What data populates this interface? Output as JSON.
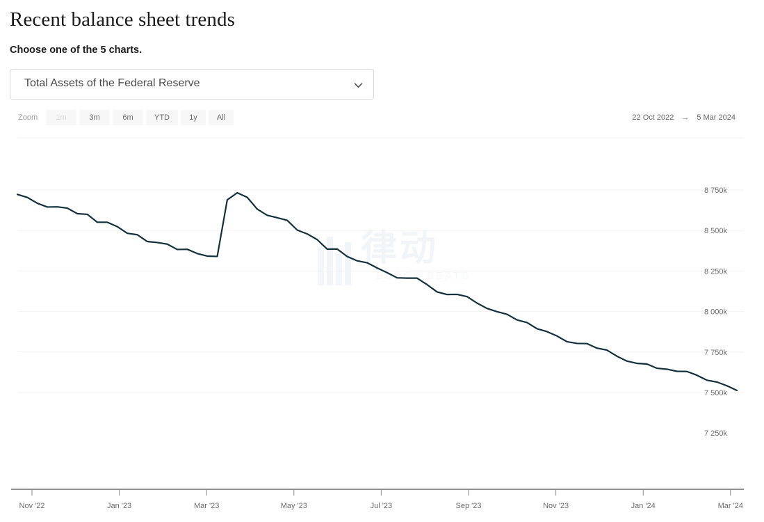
{
  "header": {
    "title": "Recent balance sheet trends",
    "subtitle": "Choose one of the 5 charts."
  },
  "select": {
    "value": "Total Assets of the Federal Reserve",
    "icon": "chevron-down-icon",
    "options": [
      "Total Assets of the Federal Reserve"
    ]
  },
  "rangebar": {
    "zoom_label": "Zoom",
    "buttons": [
      {
        "label": "1m",
        "muted": true
      },
      {
        "label": "3m",
        "muted": false
      },
      {
        "label": "6m",
        "muted": false
      },
      {
        "label": "YTD",
        "muted": false
      },
      {
        "label": "1y",
        "muted": false
      },
      {
        "label": "All",
        "muted": false
      }
    ],
    "start_date": "22 Oct 2022",
    "arrow": "→",
    "end_date": "5 Mar 2024"
  },
  "watermark": {
    "text": "律动",
    "subtext": "BLOCK BEATS",
    "color": "#dfe7ef"
  },
  "chart_data": {
    "type": "line",
    "title": "Total Assets of the Federal Reserve",
    "xlabel": "",
    "ylabel": "",
    "grid": true,
    "legend": "none",
    "line_color": "#13313d",
    "y_ticks": [
      "8 750k",
      "8 500k",
      "8 250k",
      "8 000k",
      "7 750k",
      "7 500k",
      "7 250k"
    ],
    "y_tick_values": [
      8750000,
      8500000,
      8250000,
      8000000,
      7750000,
      7500000,
      7250000
    ],
    "ylim": [
      7250000,
      8850000
    ],
    "x_ticks": [
      "Nov '22",
      "Jan '23",
      "Mar '23",
      "May '23",
      "Jul '23",
      "Sep '23",
      "Nov '23",
      "Jan '24",
      "Mar '24"
    ],
    "x": [
      "2022-10-22",
      "2022-10-29",
      "2022-11-05",
      "2022-11-12",
      "2022-11-19",
      "2022-11-26",
      "2022-12-03",
      "2022-12-10",
      "2022-12-17",
      "2022-12-24",
      "2022-12-31",
      "2023-01-07",
      "2023-01-14",
      "2023-01-21",
      "2023-01-28",
      "2023-02-04",
      "2023-02-11",
      "2023-02-18",
      "2023-02-25",
      "2023-03-04",
      "2023-03-11",
      "2023-03-18",
      "2023-03-25",
      "2023-04-01",
      "2023-04-08",
      "2023-04-15",
      "2023-04-22",
      "2023-04-29",
      "2023-05-06",
      "2023-05-13",
      "2023-05-20",
      "2023-05-27",
      "2023-06-03",
      "2023-06-10",
      "2023-06-17",
      "2023-06-24",
      "2023-07-01",
      "2023-07-08",
      "2023-07-15",
      "2023-07-22",
      "2023-07-29",
      "2023-08-05",
      "2023-08-12",
      "2023-08-19",
      "2023-08-26",
      "2023-09-02",
      "2023-09-09",
      "2023-09-16",
      "2023-09-23",
      "2023-09-30",
      "2023-10-07",
      "2023-10-14",
      "2023-10-21",
      "2023-10-28",
      "2023-11-04",
      "2023-11-11",
      "2023-11-18",
      "2023-11-25",
      "2023-12-02",
      "2023-12-09",
      "2023-12-16",
      "2023-12-23",
      "2023-12-30",
      "2024-01-06",
      "2024-01-13",
      "2024-01-20",
      "2024-01-27",
      "2024-02-03",
      "2024-02-10",
      "2024-02-17",
      "2024-02-24",
      "2024-03-02",
      "2024-03-05"
    ],
    "values": [
      8723000,
      8704000,
      8668000,
      8645000,
      8646000,
      8638000,
      8604000,
      8600000,
      8551000,
      8551000,
      8524000,
      8483000,
      8474000,
      8432000,
      8426000,
      8416000,
      8383000,
      8384000,
      8358000,
      8342000,
      8340000,
      8689000,
      8733000,
      8705000,
      8632000,
      8594000,
      8579000,
      8563000,
      8503000,
      8479000,
      8444000,
      8385000,
      8386000,
      8340000,
      8313000,
      8301000,
      8269000,
      8240000,
      8208000,
      8206000,
      8206000,
      8166000,
      8121000,
      8105000,
      8106000,
      8092000,
      8052000,
      8019000,
      7999000,
      7983000,
      7948000,
      7932000,
      7894000,
      7876000,
      7849000,
      7814000,
      7803000,
      7802000,
      7774000,
      7762000,
      7724000,
      7694000,
      7680000,
      7676000,
      7650000,
      7644000,
      7631000,
      7630000,
      7607000,
      7576000,
      7565000,
      7542000,
      7513000
    ]
  }
}
